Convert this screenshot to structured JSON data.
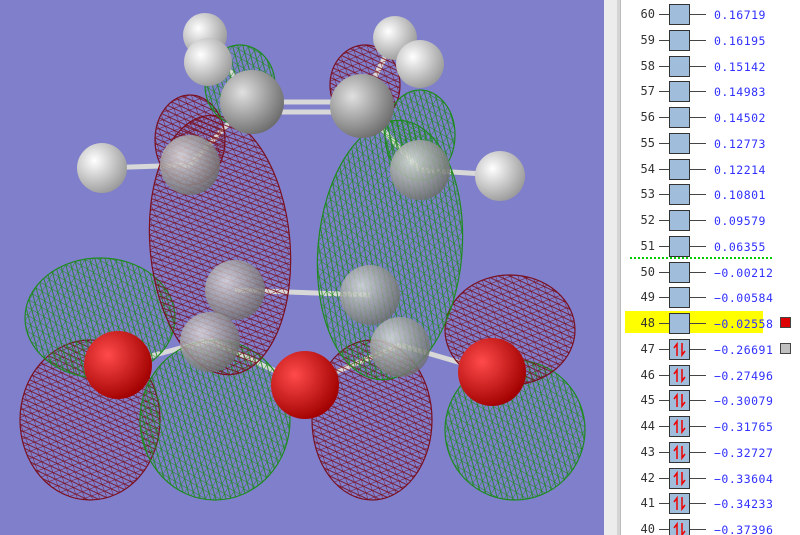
{
  "viewer": {
    "background": "#7f7fcc",
    "positive_lobe_color": "#1e8a1e",
    "negative_lobe_color": "#7a1020"
  },
  "mo_list": {
    "selected_orbital": 48,
    "highlight_color": "#ffff00",
    "energy_color": "#3030ff",
    "orbitals": [
      {
        "number": "60",
        "energy": "0.16719",
        "occupied": false
      },
      {
        "number": "59",
        "energy": "0.16195",
        "occupied": false
      },
      {
        "number": "58",
        "energy": "0.15142",
        "occupied": false
      },
      {
        "number": "57",
        "energy": "0.14983",
        "occupied": false
      },
      {
        "number": "56",
        "energy": "0.14502",
        "occupied": false
      },
      {
        "number": "55",
        "energy": "0.12773",
        "occupied": false
      },
      {
        "number": "54",
        "energy": "0.12214",
        "occupied": false
      },
      {
        "number": "53",
        "energy": "0.10801",
        "occupied": false
      },
      {
        "number": "52",
        "energy": "0.09579",
        "occupied": false
      },
      {
        "number": "51",
        "energy": "0.06355",
        "occupied": false
      },
      {
        "number": "50",
        "energy": "−0.00212",
        "occupied": false
      },
      {
        "number": "49",
        "energy": "−0.00584",
        "occupied": false
      },
      {
        "number": "48",
        "energy": "−0.02558",
        "occupied": false,
        "selected": true,
        "swatch": "#dd0000"
      },
      {
        "number": "47",
        "energy": "−0.26691",
        "occupied": true,
        "swatch": "#c0c0c0"
      },
      {
        "number": "46",
        "energy": "−0.27496",
        "occupied": true
      },
      {
        "number": "45",
        "energy": "−0.30079",
        "occupied": true
      },
      {
        "number": "44",
        "energy": "−0.31765",
        "occupied": true
      },
      {
        "number": "43",
        "energy": "−0.32727",
        "occupied": true
      },
      {
        "number": "42",
        "energy": "−0.33604",
        "occupied": true
      },
      {
        "number": "41",
        "energy": "−0.34233",
        "occupied": true
      },
      {
        "number": "40",
        "energy": "−0.37396",
        "occupied": true
      }
    ]
  }
}
